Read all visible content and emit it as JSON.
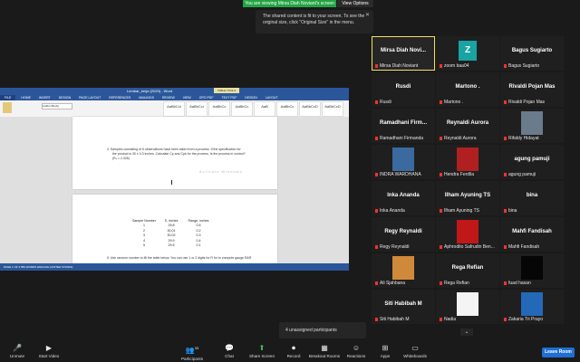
{
  "banner": {
    "share_status": "You are viewing Mirsa Diah Noviant's screen",
    "view_options": "View Options"
  },
  "tooltip": {
    "text1": "The shared content is fit to your screen. To see the",
    "text2": "original size, click \"Original Size\" in the menu."
  },
  "word": {
    "title": "Lembar_kerja (2020) - Word",
    "table_tools": "TABLE TOOLS",
    "tabs": [
      "FILE",
      "HOME",
      "INSERT",
      "DESIGN",
      "PAGE LAYOUT",
      "REFERENCES",
      "MAILINGS",
      "REVIEW",
      "VIEW",
      "GPO PDF",
      "TEXT PDF",
      "DESIGN",
      "LAYOUT"
    ],
    "font_name": "Calibri (Body)",
    "styles": [
      "AaBbCcI",
      "AaBbCcI",
      "AaBbCc",
      "AaBbCc",
      "AaB",
      "AaBbCc",
      "AaBbCcD",
      "AaBbCcD"
    ],
    "question_line1": "4.   Samples consisting of 5 observations have been taken from a process.  If the specification for",
    "question_line2": "the product is 30 ± 0.3 inches. Calculate Cp and Cpk for the process. Is the process in control?",
    "question_line3": "(Rₑ = 2.326)",
    "watermark": "Activate Windows",
    "table_headers": [
      "Sample Number",
      "X̄, inches",
      "Range, inches"
    ],
    "table_rows": [
      [
        "1",
        "29.8",
        "0.5"
      ],
      [
        "2",
        "30.01",
        "0.2"
      ],
      [
        "3",
        "30.02",
        "0.3"
      ],
      [
        "4",
        "29.9",
        "0.4"
      ],
      [
        "5",
        "29.5",
        "0.1"
      ]
    ],
    "question5": "5.   Use random number to fill the table below. You can use 1 or 2 digits for R for to compute gauge R&R",
    "status": "PAGE 1 OF 3    583 WORDS    ENGLISH (UNITED STATES)"
  },
  "participants": [
    {
      "big": "Mirsa Diah Novi...",
      "label": "Mirsa Diah Noviant",
      "active": true
    },
    {
      "big": "Z",
      "label": "zoom baa04",
      "icon": true
    },
    {
      "big": "Bagus Sugiarto",
      "label": "Bagus Sugiarto"
    },
    {
      "big": "Rusdi",
      "label": "Rusdi"
    },
    {
      "big": "Martono .",
      "label": "Martono ."
    },
    {
      "big": "Rivaldi Pojan Mas",
      "label": "Rivaldi Pojan Mas"
    },
    {
      "big": "Ramadhani  Firm...",
      "label": "Ramadhani Firmanda"
    },
    {
      "big": "Reynaldi Aurora",
      "label": "Reynaldi Aurora"
    },
    {
      "big": "",
      "label": "Rifaldy Hidayat",
      "photo": "#6a7b8c"
    },
    {
      "big": "",
      "label": "INDRA WARDHANA",
      "photo": "#3a6aa0"
    },
    {
      "big": "",
      "label": "Hendra Ferdila",
      "photo": "#b02020"
    },
    {
      "big": "agung pamuji",
      "label": "agung pamuji"
    },
    {
      "big": "Inka Ananda",
      "label": "Inka Ananda"
    },
    {
      "big": "Ilham Ayuning TS",
      "label": "Ilham Ayuning TS"
    },
    {
      "big": "bina",
      "label": "bina"
    },
    {
      "big": "Regy Reynaldi",
      "label": "Regy Reynaldi"
    },
    {
      "big": "",
      "label": "Aphrodito Safrudin Ben...",
      "photo": "#c01818"
    },
    {
      "big": "Mahfi Fandisah",
      "label": "Mahfi Fandisah"
    },
    {
      "big": "",
      "label": "Ali Sjahbana",
      "photo": "#d0893a"
    },
    {
      "big": "Rega Refian",
      "label": "Rega Refian"
    },
    {
      "big": "",
      "label": "fuad hasan",
      "photo": "#060606"
    },
    {
      "big": "Siti Habibah M",
      "label": "Siti Habibah M"
    },
    {
      "big": "",
      "label": "Nadia",
      "photo": "#f4f4f4"
    },
    {
      "big": "",
      "label": "Zakaria Tri Prayo",
      "photo": "#2468b8"
    }
  ],
  "unassigned": "4 unassigned participants",
  "toolbar": {
    "unmute": "Unmute",
    "video": "Start Video",
    "participants": "Participants",
    "participants_count": "33",
    "chat": "Chat",
    "share": "Share Screen",
    "record": "Record",
    "breakout": "Breakout Rooms",
    "reactions": "Reactions",
    "apps": "Apps",
    "whiteboards": "Whiteboards",
    "leave": "Leave Room"
  }
}
